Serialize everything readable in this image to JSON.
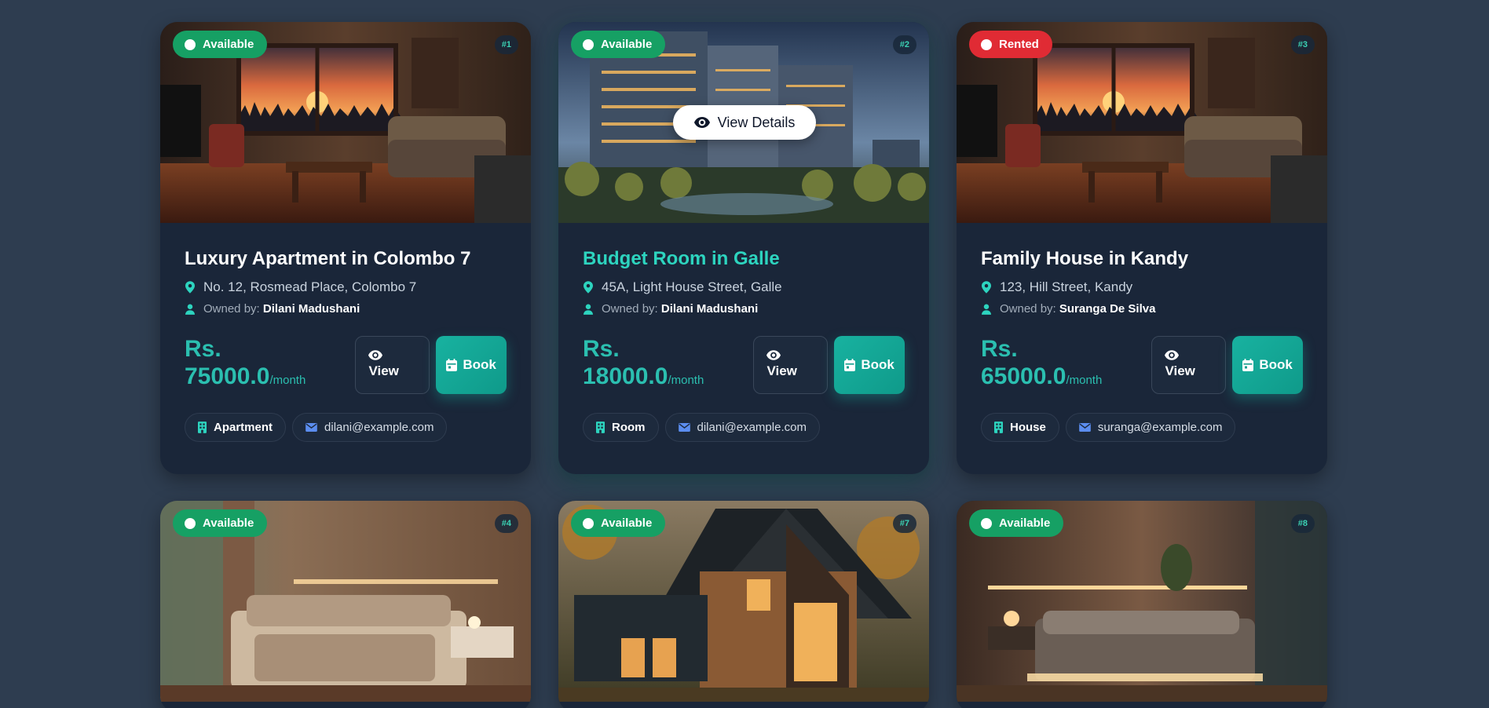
{
  "cards": [
    {
      "status": "Available",
      "status_kind": "available",
      "id": "#1",
      "title": "Luxury Apartment in Colombo 7",
      "address": "No. 12, Rosmead Place, Colombo 7",
      "owner_label": "Owned by:",
      "owner": "Dilani Madushani",
      "price_prefix": "Rs.",
      "price": "75000.0",
      "period": "/month",
      "view_label": "View",
      "book_label": "Book",
      "type": "Apartment",
      "email": "dilani@example.com",
      "image": "living-room-sunset"
    },
    {
      "status": "Available",
      "status_kind": "available",
      "id": "#2",
      "title": "Budget Room in Galle",
      "address": "45A, Light House Street, Galle",
      "owner_label": "Owned by:",
      "owner": "Dilani Madushani",
      "price_prefix": "Rs.",
      "price": "18000.0",
      "period": "/month",
      "view_label": "View",
      "book_label": "Book",
      "type": "Room",
      "email": "dilani@example.com",
      "image": "apartment-tower",
      "overlay_label": "View Details"
    },
    {
      "status": "Rented",
      "status_kind": "rented",
      "id": "#3",
      "title": "Family House in Kandy",
      "address": "123, Hill Street, Kandy",
      "owner_label": "Owned by:",
      "owner": "Suranga De Silva",
      "price_prefix": "Rs.",
      "price": "65000.0",
      "period": "/month",
      "view_label": "View",
      "book_label": "Book",
      "type": "House",
      "email": "suranga@example.com",
      "image": "living-room-sunset"
    },
    {
      "status": "Available",
      "status_kind": "available",
      "id": "#4",
      "image": "bedroom-beige"
    },
    {
      "status": "Available",
      "status_kind": "available",
      "id": "#7",
      "image": "modern-cabin"
    },
    {
      "status": "Available",
      "status_kind": "available",
      "id": "#8",
      "image": "bedroom-dark"
    }
  ],
  "colors": {
    "accent": "#2dd4bf",
    "available": "#16a064",
    "rented": "#e02b34",
    "card_bg": "#1a2639",
    "page_bg": "#2e3d50"
  }
}
